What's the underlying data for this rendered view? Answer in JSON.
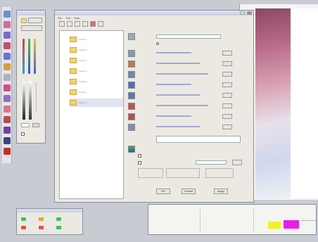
{
  "toolbox": {
    "tools": [
      {
        "icon": "pointer-icon",
        "color": "#6a8fd0"
      },
      {
        "icon": "zoom-icon",
        "color": "#d86a9a"
      },
      {
        "icon": "brush-icon",
        "color": "#7a6ad0"
      },
      {
        "icon": "pen-icon",
        "color": "#c05070"
      },
      {
        "icon": "eraser-icon",
        "color": "#7070d0"
      },
      {
        "icon": "select-icon",
        "color": "#d0a040"
      },
      {
        "icon": "ruler-icon",
        "color": "#b0b0c0"
      },
      {
        "icon": "measure-icon",
        "color": "#d05080"
      },
      {
        "icon": "text-icon",
        "color": "#9070c0"
      },
      {
        "icon": "circle-icon",
        "color": "#e07090"
      },
      {
        "icon": "person-icon",
        "color": "#b05050"
      },
      {
        "icon": "stamp-icon",
        "color": "#7040a0"
      },
      {
        "icon": "bucket-icon",
        "color": "#404080"
      },
      {
        "icon": "marker-icon",
        "color": "#c03030"
      }
    ]
  },
  "colors": {
    "accent_pink": "#e81ee8",
    "accent_yellow": "#f5f022",
    "link": "#4a5fb0"
  },
  "dialog": {
    "menu": [
      "File",
      "Edit",
      "Help"
    ],
    "folders": [
      "Folder A",
      "Folder B",
      "Folder C",
      "Folder D",
      "Folder E",
      "Folder F",
      "Folder G"
    ],
    "buttons": {
      "ok": "OK",
      "cancel": "Cancel",
      "apply": "Apply"
    }
  }
}
